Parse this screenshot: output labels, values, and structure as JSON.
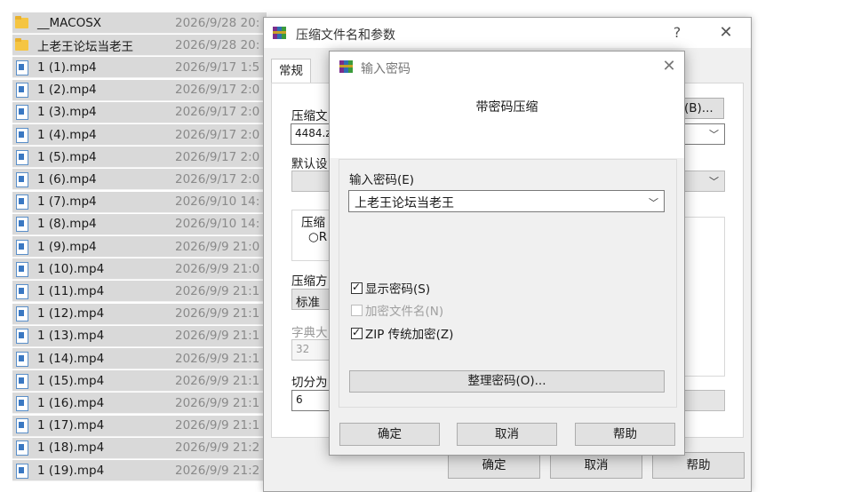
{
  "explorer": {
    "files": [
      {
        "name": "__MACOSX",
        "date": "2026/9/28 20:",
        "icon": "folder-icon"
      },
      {
        "name": "上老王论坛当老王",
        "date": "2026/9/28 20:",
        "icon": "folder-icon"
      },
      {
        "name": "1 (1).mp4",
        "date": "2026/9/17 1:5",
        "icon": "video-file-icon"
      },
      {
        "name": "1 (2).mp4",
        "date": "2026/9/17 2:0",
        "icon": "video-file-icon"
      },
      {
        "name": "1 (3).mp4",
        "date": "2026/9/17 2:0",
        "icon": "video-file-icon"
      },
      {
        "name": "1 (4).mp4",
        "date": "2026/9/17 2:0",
        "icon": "video-file-icon"
      },
      {
        "name": "1 (5).mp4",
        "date": "2026/9/17 2:0",
        "icon": "video-file-icon"
      },
      {
        "name": "1 (6).mp4",
        "date": "2026/9/17 2:0",
        "icon": "video-file-icon"
      },
      {
        "name": "1 (7).mp4",
        "date": "2026/9/10 14:",
        "icon": "video-file-icon"
      },
      {
        "name": "1 (8).mp4",
        "date": "2026/9/10 14:",
        "icon": "video-file-icon"
      },
      {
        "name": "1 (9).mp4",
        "date": "2026/9/9 21:0",
        "icon": "video-file-icon"
      },
      {
        "name": "1 (10).mp4",
        "date": "2026/9/9 21:0",
        "icon": "video-file-icon"
      },
      {
        "name": "1 (11).mp4",
        "date": "2026/9/9 21:1",
        "icon": "video-file-icon"
      },
      {
        "name": "1 (12).mp4",
        "date": "2026/9/9 21:1",
        "icon": "video-file-icon"
      },
      {
        "name": "1 (13).mp4",
        "date": "2026/9/9 21:1",
        "icon": "video-file-icon"
      },
      {
        "name": "1 (14).mp4",
        "date": "2026/9/9 21:1",
        "icon": "video-file-icon"
      },
      {
        "name": "1 (15).mp4",
        "date": "2026/9/9 21:1",
        "icon": "video-file-icon"
      },
      {
        "name": "1 (16).mp4",
        "date": "2026/9/9 21:1",
        "icon": "video-file-icon"
      },
      {
        "name": "1 (17).mp4",
        "date": "2026/9/9 21:1",
        "icon": "video-file-icon"
      },
      {
        "name": "1 (18).mp4",
        "date": "2026/9/9 21:2",
        "icon": "video-file-icon"
      },
      {
        "name": "1 (19).mp4",
        "date": "2026/9/9 21:2",
        "icon": "video-file-icon"
      }
    ]
  },
  "archive_dialog": {
    "title": "压缩文件名和参数",
    "help_glyph": "?",
    "close_glyph": "✕",
    "tab_general": "常规",
    "archive_name_label": "压缩文",
    "archive_name_value": "4484.z",
    "browse_button": "(B)...",
    "default_profile_label": "默认设",
    "format_group_label": "压缩",
    "format_radio_label": "R",
    "method_label": "压缩方",
    "method_value": "标准",
    "dict_label": "字典大",
    "dict_value": "32",
    "split_label": "切分为",
    "split_value": "6",
    "ok_button": "确定",
    "cancel_button": "取消",
    "help_button": "帮助"
  },
  "password_dialog": {
    "title": "输入密码",
    "close_glyph": "✕",
    "header": "带密码压缩",
    "password_label": "输入密码(E)",
    "password_value": "上老王论坛当老王",
    "show_password_label": "显示密码(S)",
    "show_password_checked": true,
    "encrypt_names_label": "加密文件名(N)",
    "encrypt_names_checked": false,
    "zip_legacy_label": "ZIP 传统加密(Z)",
    "zip_legacy_checked": true,
    "organize_button": "整理密码(O)...",
    "ok_button": "确定",
    "cancel_button": "取消",
    "help_button": "帮助"
  }
}
